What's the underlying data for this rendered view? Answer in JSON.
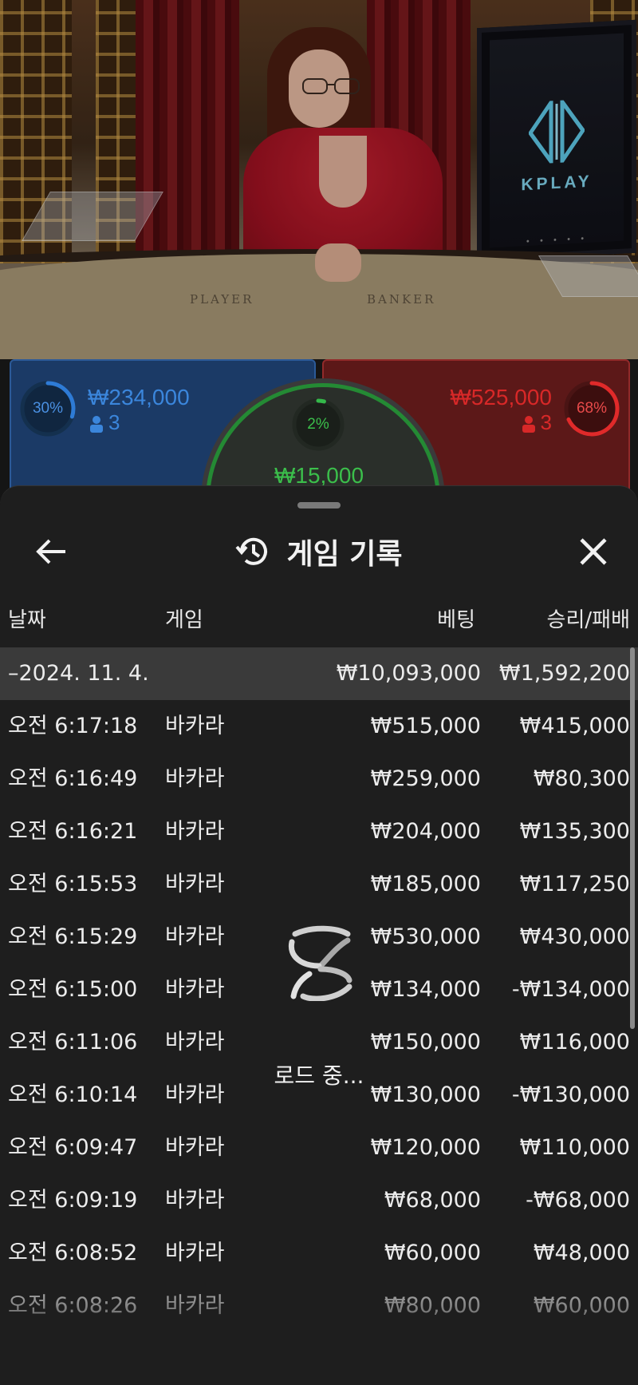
{
  "video": {
    "table_labels": {
      "player": "PLAYER",
      "banker": "BANKER"
    },
    "monitor_brand": "KPLAY",
    "monitor_dots": "• • • • •"
  },
  "bets": {
    "player": {
      "percent_label": "30%",
      "percent": 30,
      "amount": "₩234,000",
      "count": "3",
      "color": "#2e7bd6"
    },
    "banker": {
      "percent_label": "68%",
      "percent": 68,
      "amount": "₩525,000",
      "count": "3",
      "color": "#e02a2a"
    },
    "tie": {
      "percent_label": "2%",
      "percent": 2,
      "amount": "₩15,000",
      "color": "#34b84a"
    }
  },
  "history": {
    "title": "게임 기록",
    "back_icon": "arrow-left-icon",
    "history_icon": "history-clock-icon",
    "close_icon": "close-icon",
    "columns": {
      "date": "날짜",
      "game": "게임",
      "bet": "베팅",
      "win_loss": "승리/패배"
    },
    "date_group": {
      "label": "–2024. 11. 4.",
      "bet": "₩10,093,000",
      "win_loss": "₩1,592,200"
    },
    "rows": [
      {
        "time": "오전 6:17:18",
        "game": "바카라",
        "bet": "₩515,000",
        "win_loss": "₩415,000"
      },
      {
        "time": "오전 6:16:49",
        "game": "바카라",
        "bet": "₩259,000",
        "win_loss": "₩80,300"
      },
      {
        "time": "오전 6:16:21",
        "game": "바카라",
        "bet": "₩204,000",
        "win_loss": "₩135,300"
      },
      {
        "time": "오전 6:15:53",
        "game": "바카라",
        "bet": "₩185,000",
        "win_loss": "₩117,250"
      },
      {
        "time": "오전 6:15:29",
        "game": "바카라",
        "bet": "₩530,000",
        "win_loss": "₩430,000"
      },
      {
        "time": "오전 6:15:00",
        "game": "바카라",
        "bet": "₩134,000",
        "win_loss": "-₩134,000"
      },
      {
        "time": "오전 6:11:06",
        "game": "바카라",
        "bet": "₩150,000",
        "win_loss": "₩116,000"
      },
      {
        "time": "오전 6:10:14",
        "game": "바카라",
        "bet": "₩130,000",
        "win_loss": "-₩130,000"
      },
      {
        "time": "오전 6:09:47",
        "game": "바카라",
        "bet": "₩120,000",
        "win_loss": "₩110,000"
      },
      {
        "time": "오전 6:09:19",
        "game": "바카라",
        "bet": "₩68,000",
        "win_loss": "-₩68,000"
      },
      {
        "time": "오전 6:08:52",
        "game": "바카라",
        "bet": "₩60,000",
        "win_loss": "₩48,000"
      },
      {
        "time": "오전 6:08:26",
        "game": "바카라",
        "bet": "₩80,000",
        "win_loss": "₩60,000"
      }
    ],
    "loading_text": "로드 중..."
  }
}
